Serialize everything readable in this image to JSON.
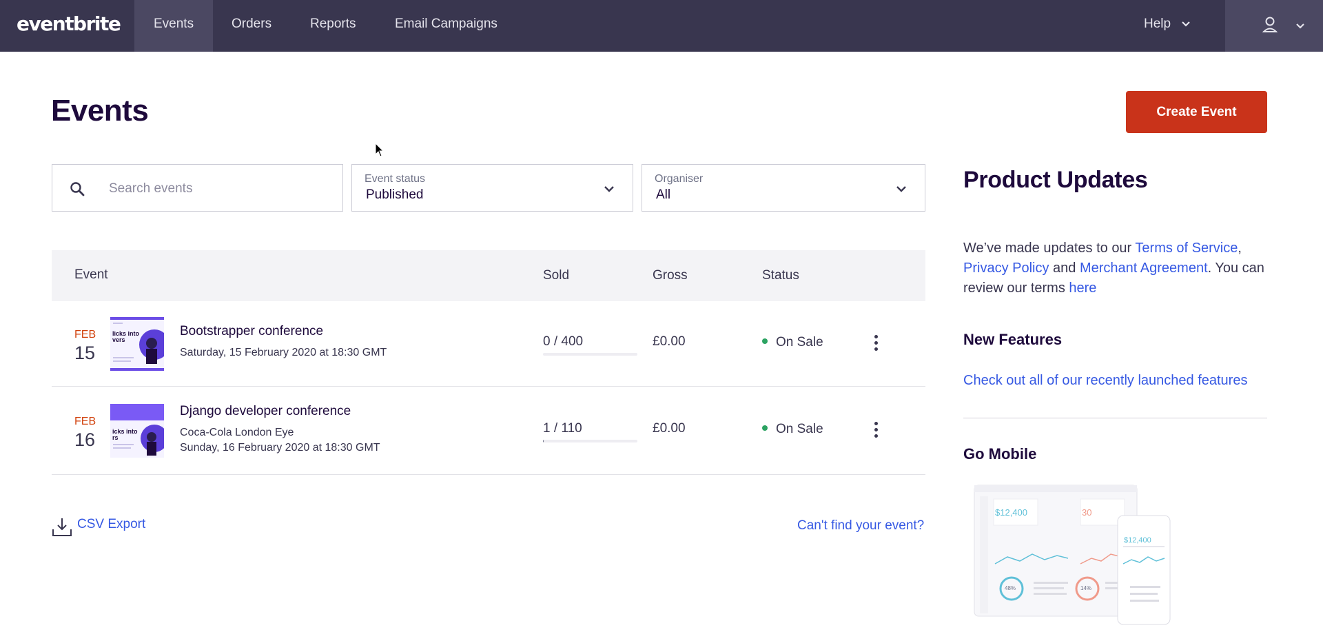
{
  "nav": {
    "logo": "eventbrite",
    "items": [
      {
        "label": "Events"
      },
      {
        "label": "Orders"
      },
      {
        "label": "Reports"
      },
      {
        "label": "Email Campaigns"
      }
    ],
    "help_label": "Help",
    "user_icon": "user-icon"
  },
  "page": {
    "title": "Events",
    "create_button": "Create Event"
  },
  "filters": {
    "search_placeholder": "Search events",
    "search_value": "",
    "event_status": {
      "label": "Event status",
      "value": "Published"
    },
    "organiser": {
      "label": "Organiser",
      "value": "All"
    }
  },
  "table": {
    "headers": {
      "event": "Event",
      "sold": "Sold",
      "gross": "Gross",
      "status": "Status"
    },
    "rows": [
      {
        "month": "FEB",
        "day": "15",
        "title": "Bootstrapper conference",
        "venue": "",
        "datetime": "Saturday, 15 February 2020 at 18:30 GMT",
        "sold": "0 / 400",
        "sold_fraction": 0,
        "gross": "£0.00",
        "status": "On Sale",
        "thumb_text": "licks into\nvers"
      },
      {
        "month": "FEB",
        "day": "16",
        "title": "Django developer conference",
        "venue": "Coca-Cola London Eye",
        "datetime": "Sunday, 16 February 2020 at 18:30 GMT",
        "sold": "1 / 110",
        "sold_fraction": 0.009,
        "gross": "£0.00",
        "status": "On Sale",
        "thumb_text": "icks into\nrs"
      }
    ]
  },
  "footer": {
    "csv_export": "CSV Export",
    "cant_find": "Can't find your event?"
  },
  "sidebar": {
    "title": "Product Updates",
    "updates_text": {
      "prefix": "We’ve made updates to our ",
      "terms": "Terms of Service",
      "comma": ",",
      "privacy": "Privacy Policy",
      "and": " and ",
      "merchant": "Merchant Agreement",
      "review": ". You can review our terms ",
      "here": "here"
    },
    "new_features_title": "New Features",
    "new_features_link": "Check out all of our recently launched features",
    "go_mobile_title": "Go Mobile",
    "mobile_preview": {
      "value1": "$12,400",
      "value2": "30",
      "pct1": "48%",
      "pct2": "14%",
      "phone_value": "$12,400"
    }
  },
  "colors": {
    "nav_bg": "#39364f",
    "brand_orange": "#c9331a",
    "link_blue": "#3659e3",
    "status_green": "#2ca362",
    "date_red": "#d1410c"
  }
}
